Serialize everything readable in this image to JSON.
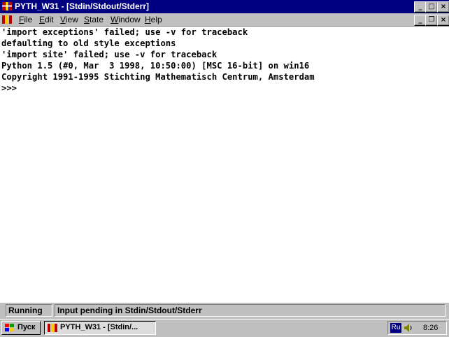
{
  "window": {
    "title": "PYTH_W31 - [Stdin/Stdout/Stderr]",
    "controls": {
      "minimize": "_",
      "maximize": "□",
      "close": "×"
    },
    "child_controls": {
      "minimize": "_",
      "restore": "❐",
      "close": "×"
    }
  },
  "menu": [
    {
      "label": "File",
      "accel": "F",
      "rest": "ile"
    },
    {
      "label": "Edit",
      "accel": "E",
      "rest": "dit"
    },
    {
      "label": "View",
      "accel": "V",
      "rest": "iew"
    },
    {
      "label": "State",
      "accel": "S",
      "rest": "tate"
    },
    {
      "label": "Window",
      "accel": "W",
      "rest": "indow"
    },
    {
      "label": "Help",
      "accel": "H",
      "rest": "elp"
    }
  ],
  "console": {
    "lines": [
      "'import exceptions' failed; use -v for traceback",
      "defaulting to old style exceptions",
      "'import site' failed; use -v for traceback",
      "Python 1.5 (#0, Mar  3 1998, 10:50:00) [MSC 16-bit] on win16",
      "Copyright 1991-1995 Stichting Mathematisch Centrum, Amsterdam",
      ">>> "
    ]
  },
  "status": {
    "state": "Running",
    "message": "Input pending in Stdin/Stdout/Stderr"
  },
  "taskbar": {
    "start_label": "Пуск",
    "task_label": "PYTH_W31 - [Stdin/...",
    "lang": "Ru",
    "clock": "8:26"
  },
  "colors": {
    "titlebar": "#000080",
    "face": "#c0c0c0",
    "console_bg": "#ffffff"
  }
}
